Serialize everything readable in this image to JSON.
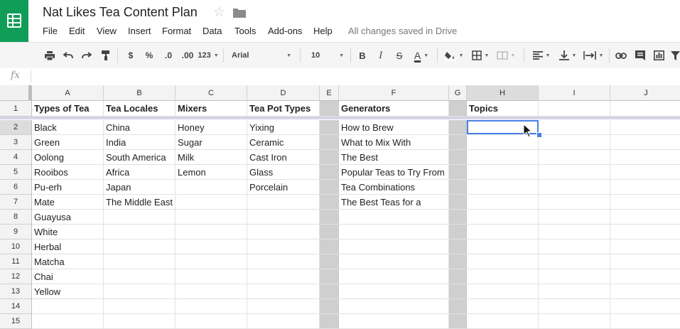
{
  "document": {
    "title": "Nat Likes Tea Content Plan",
    "save_status": "All changes saved in Drive"
  },
  "menu": [
    "File",
    "Edit",
    "View",
    "Insert",
    "Format",
    "Data",
    "Tools",
    "Add-ons",
    "Help"
  ],
  "toolbar": {
    "currency": "$",
    "percent": "%",
    "decrease_decimal": ".0",
    "increase_decimal": ".00",
    "more_formats": "123",
    "font": "Arial",
    "font_size": "10",
    "bold": "B",
    "italic": "I",
    "strikethrough": "S",
    "text_color": "A"
  },
  "formula_bar": {
    "fx_label": "fx",
    "value": ""
  },
  "sheet": {
    "columns": [
      "A",
      "B",
      "C",
      "D",
      "E",
      "F",
      "G",
      "H",
      "I",
      "J"
    ],
    "active_column": "H",
    "active_row": 2,
    "rows": [
      {
        "num": "1",
        "cells": [
          "Types of Tea",
          "Tea Locales",
          "Mixers",
          "Tea Pot Types",
          "",
          "Generators",
          "",
          "Topics",
          "",
          ""
        ]
      },
      {
        "num": "2",
        "cells": [
          "Black",
          "China",
          "Honey",
          "Yixing",
          "",
          "How to Brew",
          "",
          "",
          "",
          ""
        ]
      },
      {
        "num": "3",
        "cells": [
          "Green",
          "India",
          "Sugar",
          "Ceramic",
          "",
          "What to Mix With",
          "",
          "",
          "",
          ""
        ]
      },
      {
        "num": "4",
        "cells": [
          "Oolong",
          "South America",
          "Milk",
          "Cast Iron",
          "",
          "The Best",
          "",
          "",
          "",
          ""
        ]
      },
      {
        "num": "5",
        "cells": [
          "Rooibos",
          "Africa",
          "Lemon",
          "Glass",
          "",
          "Popular Teas to Try From",
          "",
          "",
          "",
          ""
        ]
      },
      {
        "num": "6",
        "cells": [
          "Pu-erh",
          "Japan",
          "",
          "Porcelain",
          "",
          "Tea Combinations",
          "",
          "",
          "",
          ""
        ]
      },
      {
        "num": "7",
        "cells": [
          "Mate",
          "The Middle East",
          "",
          "",
          "",
          "The Best Teas for a",
          "",
          "",
          "",
          ""
        ]
      },
      {
        "num": "8",
        "cells": [
          "Guayusa",
          "",
          "",
          "",
          "",
          "",
          "",
          "",
          "",
          ""
        ]
      },
      {
        "num": "9",
        "cells": [
          "White",
          "",
          "",
          "",
          "",
          "",
          "",
          "",
          "",
          ""
        ]
      },
      {
        "num": "10",
        "cells": [
          "Herbal",
          "",
          "",
          "",
          "",
          "",
          "",
          "",
          "",
          ""
        ]
      },
      {
        "num": "11",
        "cells": [
          "Matcha",
          "",
          "",
          "",
          "",
          "",
          "",
          "",
          "",
          ""
        ]
      },
      {
        "num": "12",
        "cells": [
          "Chai",
          "",
          "",
          "",
          "",
          "",
          "",
          "",
          "",
          ""
        ]
      },
      {
        "num": "13",
        "cells": [
          "Yellow",
          "",
          "",
          "",
          "",
          "",
          "",
          "",
          "",
          ""
        ]
      },
      {
        "num": "14",
        "cells": [
          "",
          "",
          "",
          "",
          "",
          "",
          "",
          "",
          "",
          ""
        ]
      },
      {
        "num": "15",
        "cells": [
          "",
          "",
          "",
          "",
          "",
          "",
          "",
          "",
          "",
          ""
        ]
      }
    ]
  },
  "colors": {
    "brand": "#0f9d58",
    "selection": "#4a80e4",
    "hidden_column_fill": "#cfcfcf",
    "freeze_bar": "#d4d4e8"
  },
  "icons": [
    "sheets-logo-icon",
    "star-icon",
    "folder-icon",
    "print-icon",
    "undo-icon",
    "redo-icon",
    "paint-format-icon",
    "fill-color-icon",
    "borders-icon",
    "merge-cells-icon",
    "align-left-icon",
    "vertical-align-icon",
    "text-wrap-icon",
    "link-icon",
    "comment-icon",
    "chart-icon",
    "filter-icon",
    "mouse-pointer-icon"
  ]
}
